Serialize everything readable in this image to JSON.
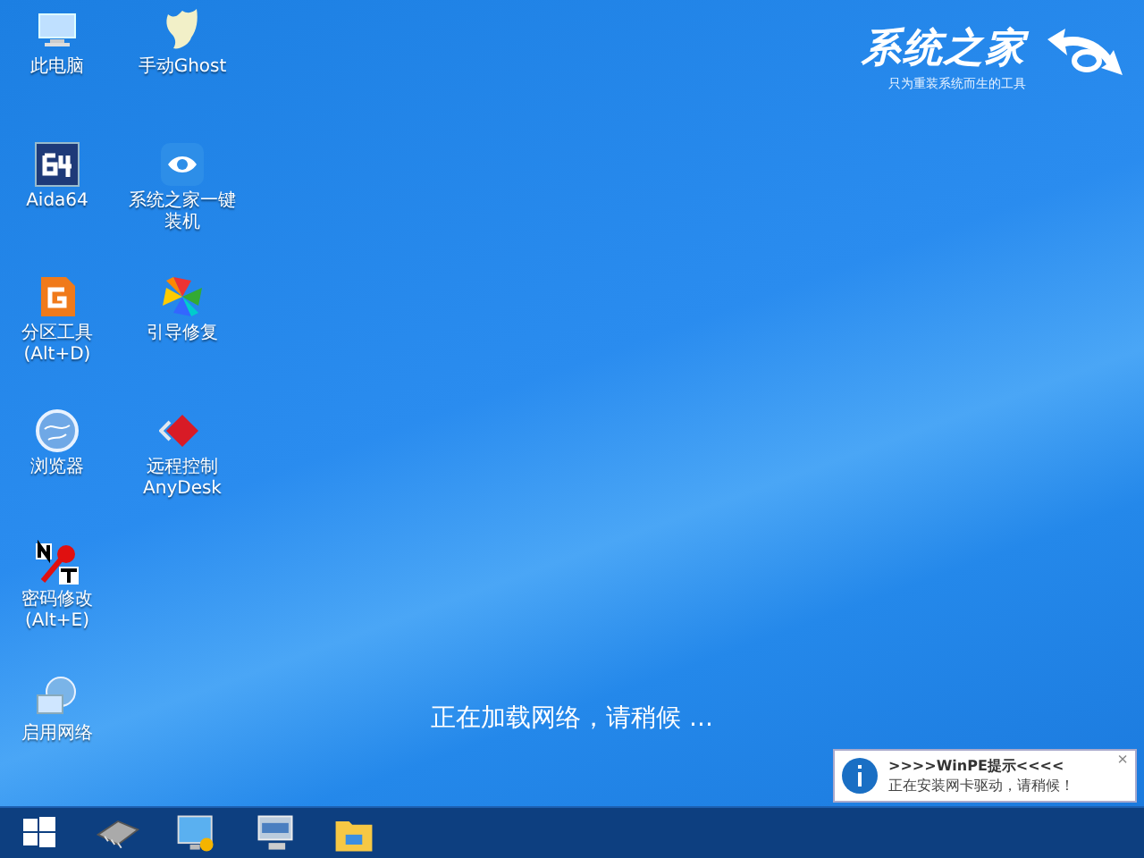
{
  "desktop_icons": [
    {
      "label": "此电脑"
    },
    {
      "label": "Aida64"
    },
    {
      "label": "分区工具\n(Alt+D)"
    },
    {
      "label": "浏览器"
    },
    {
      "label": "密码修改\n(Alt+E)"
    },
    {
      "label": "启用网络"
    },
    {
      "label": "手动Ghost"
    },
    {
      "label": "系统之家一键装机"
    },
    {
      "label": "引导修复"
    },
    {
      "label": "远程控制\nAnyDesk"
    }
  ],
  "logo": {
    "title": "系统之家",
    "subtitle": "只为重装系统而生的工具"
  },
  "status_message": "正在加载网络，请稍候 ...",
  "notification": {
    "title": ">>>>WinPE提示<<<<",
    "message": "正在安装网卡驱动，请稍候！",
    "close": "×"
  }
}
